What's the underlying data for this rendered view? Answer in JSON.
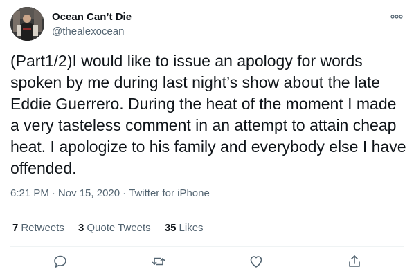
{
  "author": {
    "name": "Ocean Can’t Die",
    "handle": "@thealexocean"
  },
  "header": {
    "more_icon": "more-horizontal-icon"
  },
  "tweet": {
    "text": "(Part1/2)I would like to issue an apology for words\nspoken by me during last night’s show about the late\nEddie Guerrero. During the heat of the moment I made\na very tasteless comment in an attempt to attain cheap\nheat. I apologize to his family and everybody else I have\noffended."
  },
  "meta": {
    "time": "6:21 PM",
    "separator": "·",
    "date": "Nov 15, 2020",
    "source": "Twitter for iPhone"
  },
  "stats": {
    "retweets_count": "7",
    "retweets_label": "Retweets",
    "quotes_count": "3",
    "quotes_label": "Quote Tweets",
    "likes_count": "35",
    "likes_label": "Likes"
  },
  "actions": {
    "reply_icon": "reply-icon",
    "retweet_icon": "retweet-icon",
    "like_icon": "like-icon",
    "share_icon": "share-icon"
  },
  "colors": {
    "text": "#0f1419",
    "secondary": "#536471",
    "divider": "#eff3f4"
  }
}
